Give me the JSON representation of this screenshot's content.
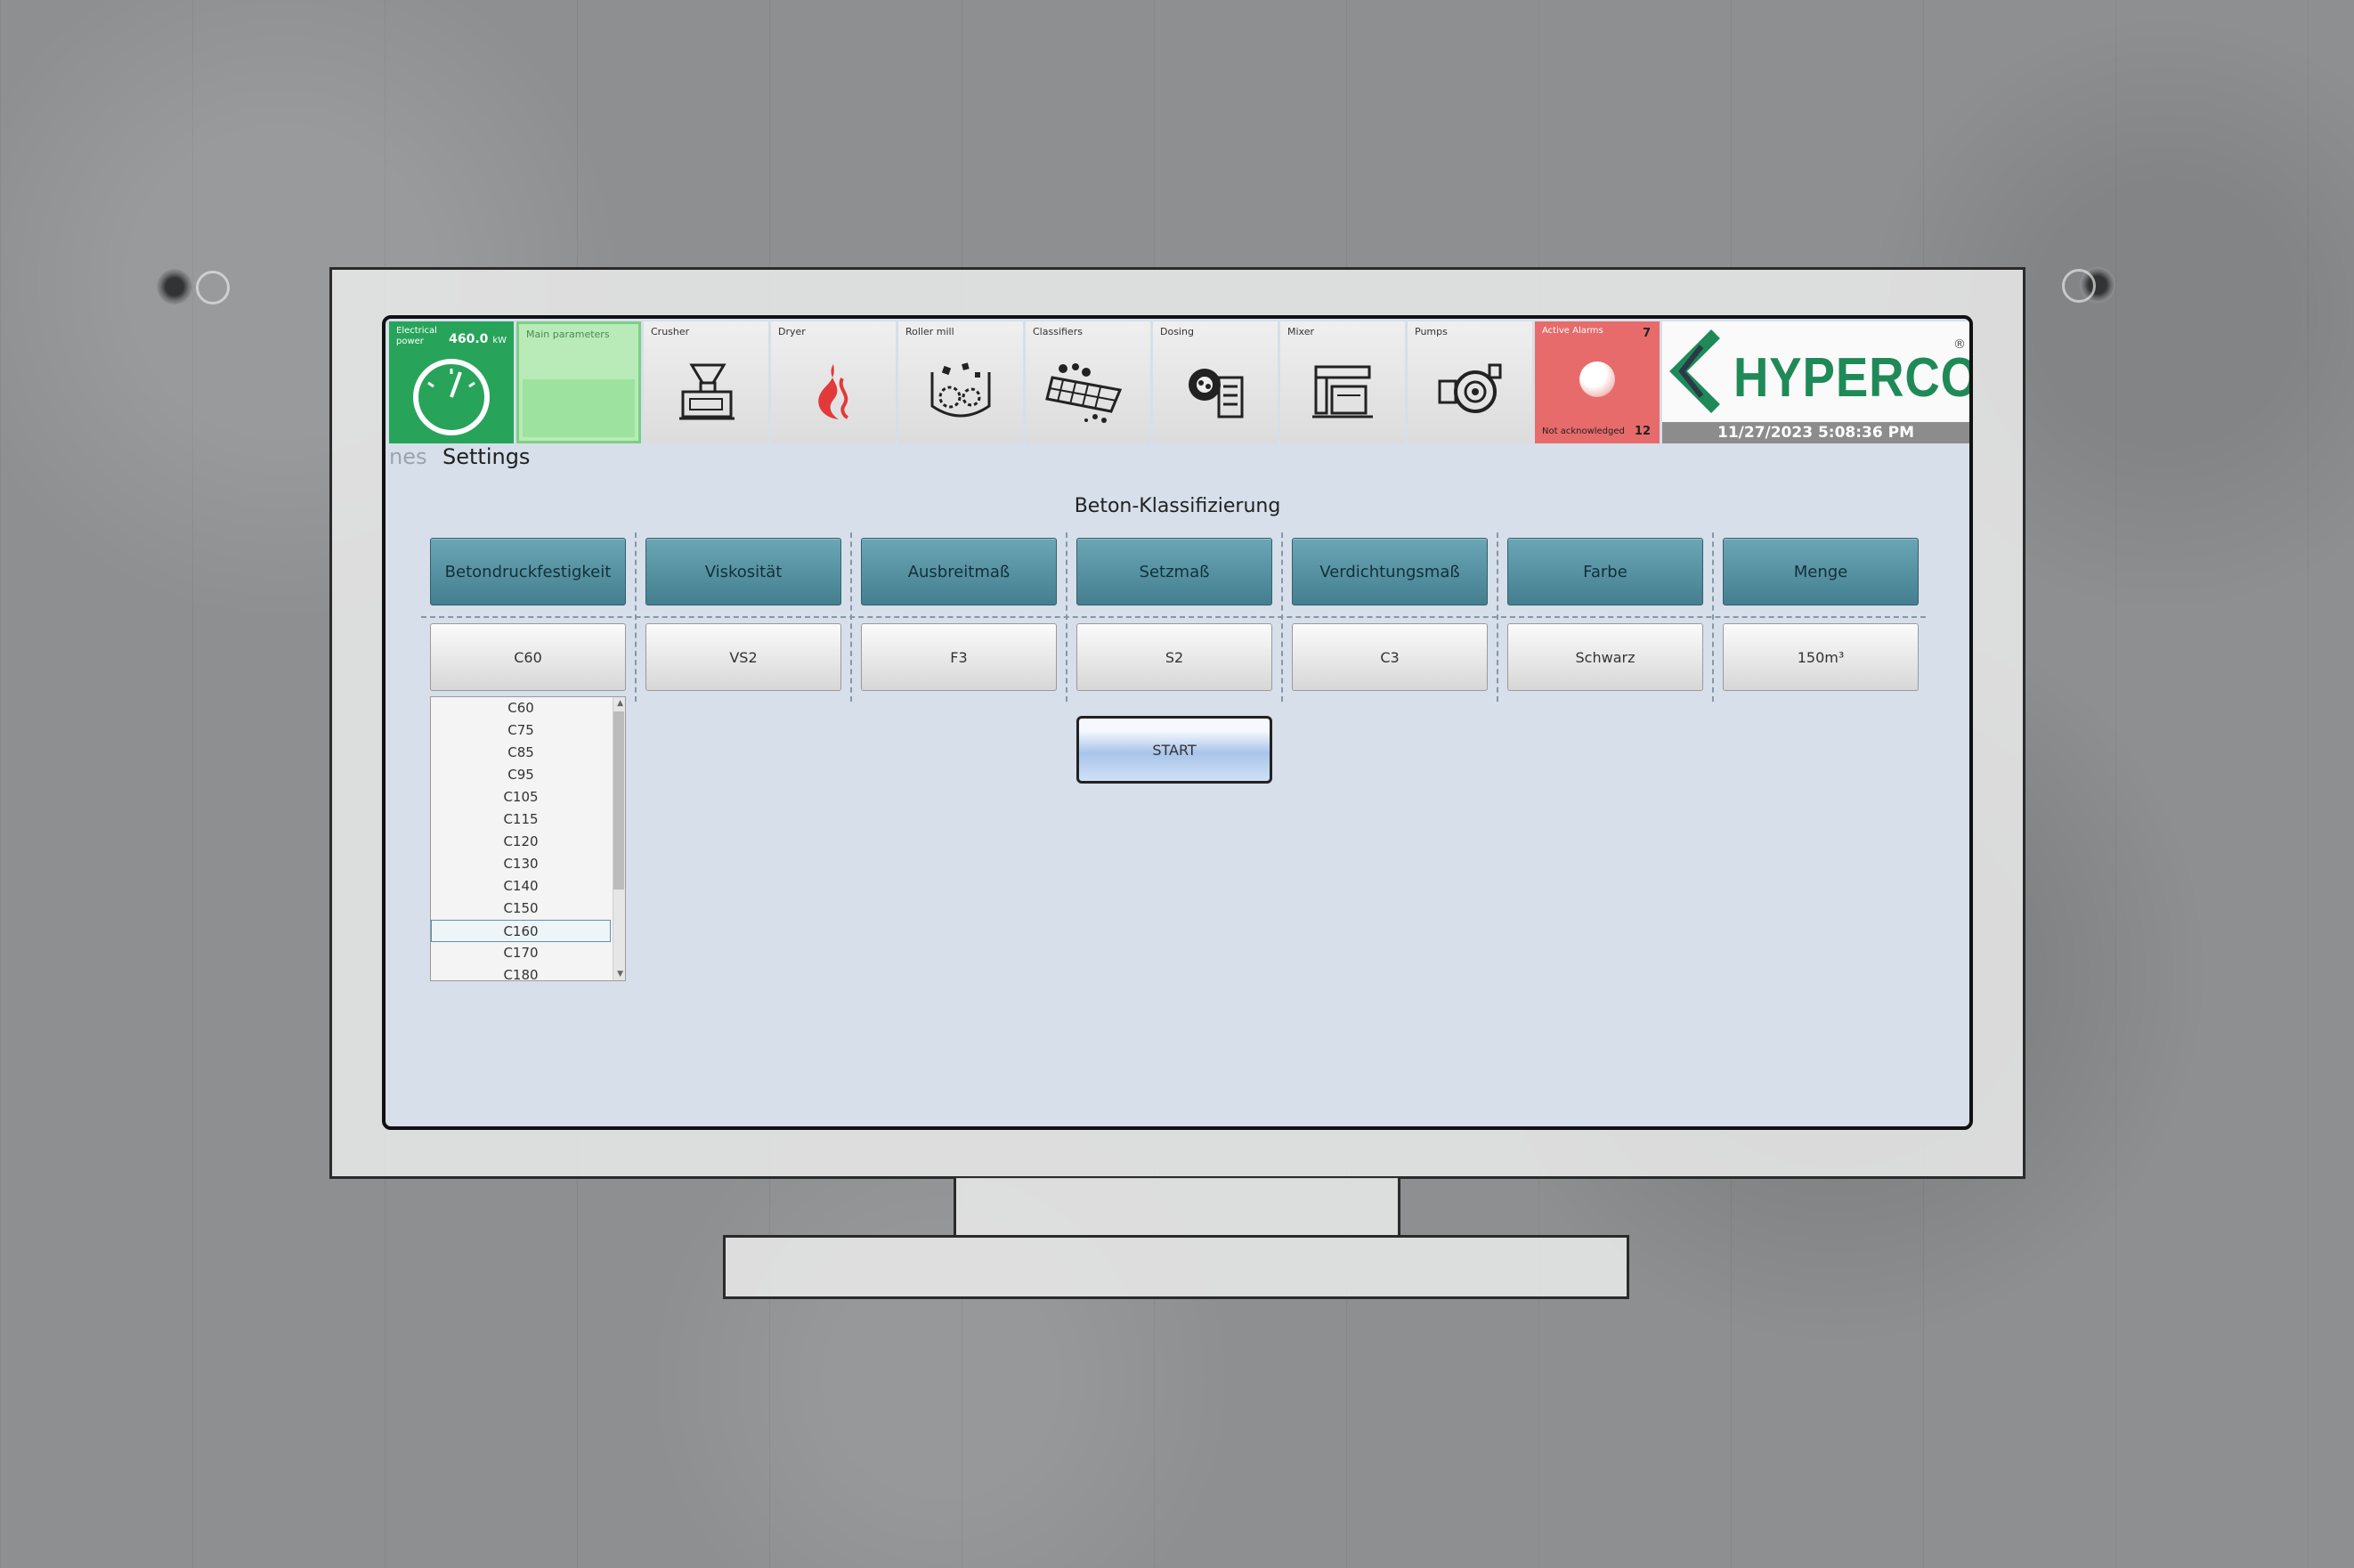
{
  "header": {
    "power": {
      "label": "Electrical power",
      "value": "460.0",
      "unit": "kW"
    },
    "tiles": [
      {
        "label": "Main parameters",
        "icon": "main-parameters-icon"
      },
      {
        "label": "Crusher",
        "icon": "crusher-icon"
      },
      {
        "label": "Dryer",
        "icon": "dryer-flame-icon"
      },
      {
        "label": "Roller mill",
        "icon": "roller-mill-icon"
      },
      {
        "label": "Classifiers",
        "icon": "classifier-icon"
      },
      {
        "label": "Dosing",
        "icon": "dosing-icon"
      },
      {
        "label": "Mixer",
        "icon": "mixer-icon"
      },
      {
        "label": "Pumps",
        "icon": "pump-icon"
      }
    ],
    "alarms": {
      "active_label": "Active Alarms",
      "active_count": "7",
      "na_label": "Not acknowledged",
      "na_count": "12"
    },
    "logo_text": "HYPERCON",
    "logo_reg": "®",
    "datetime": "11/27/2023 5:08:36 PM"
  },
  "nav": {
    "previous": "nes",
    "current": "Settings"
  },
  "page": {
    "title": "Beton-Klassifizierung",
    "categories": [
      {
        "label": "Betondruckfestigkeit",
        "value": "C60"
      },
      {
        "label": "Viskosität",
        "value": "VS2"
      },
      {
        "label": "Ausbreitmaß",
        "value": "F3"
      },
      {
        "label": "Setzmaß",
        "value": "S2"
      },
      {
        "label": "Verdichtungsmaß",
        "value": "C3"
      },
      {
        "label": "Farbe",
        "value": "Schwarz"
      },
      {
        "label": "Menge",
        "value": "150m³"
      }
    ],
    "dropdown_options": [
      "C60",
      "C75",
      "C85",
      "C95",
      "C105",
      "C115",
      "C120",
      "C130",
      "C140",
      "C150",
      "C160",
      "C170",
      "C180"
    ],
    "dropdown_highlighted": "C160",
    "start_label": "START"
  },
  "colors": {
    "accent_teal": "#5a97a8",
    "power_green": "#27a45a",
    "alarm_red": "#e76b6b",
    "brand_green": "#1f8a58"
  }
}
